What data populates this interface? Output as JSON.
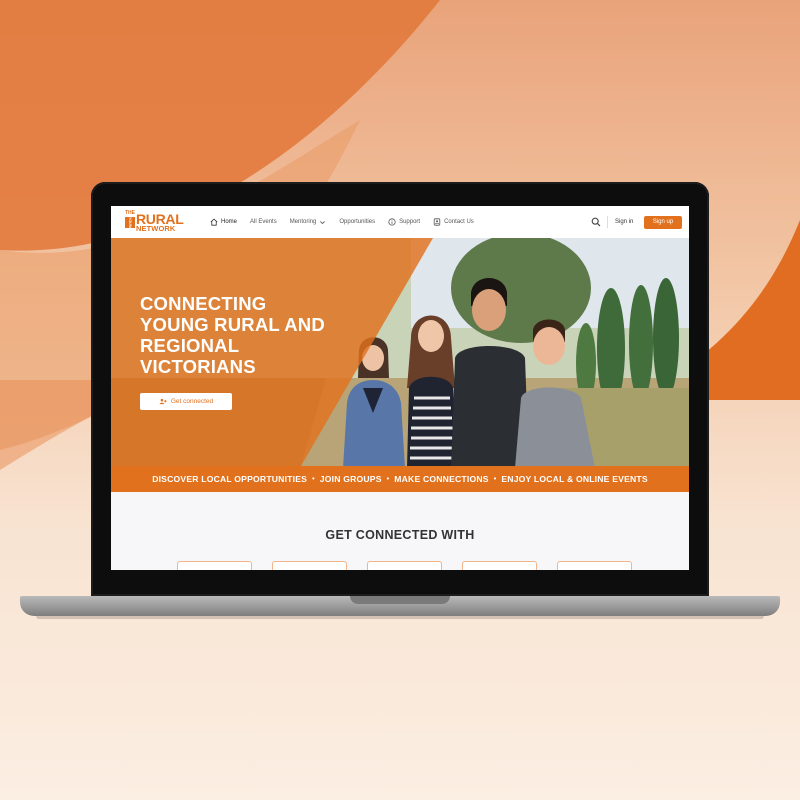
{
  "logo": {
    "the": "THE",
    "young": "YOUNG",
    "rural": "RURAL",
    "network": "NETWORK"
  },
  "nav": {
    "items": [
      {
        "label": "Home",
        "icon": "home-icon",
        "active": true
      },
      {
        "label": "All Events"
      },
      {
        "label": "Mentoring",
        "icon": "chevron-down-icon"
      },
      {
        "label": "Opportunities"
      },
      {
        "label": "Support",
        "icon": "info-icon"
      },
      {
        "label": "Contact Us",
        "icon": "contact-icon"
      }
    ],
    "signin": "Sign in",
    "signup": "Sign up"
  },
  "hero": {
    "title": "CONNECTING YOUNG RURAL AND REGIONAL VICTORIANS",
    "button": "Get connected"
  },
  "strip": {
    "items": [
      "DISCOVER LOCAL OPPORTUNITIES",
      "JOIN GROUPS",
      "MAKE CONNECTIONS",
      "ENJOY LOCAL & ONLINE EVENTS"
    ],
    "separator": "•"
  },
  "section": {
    "title": "GET CONNECTED WITH"
  },
  "colors": {
    "brand": "#e2711d",
    "background_light": "#f8e3d1"
  }
}
